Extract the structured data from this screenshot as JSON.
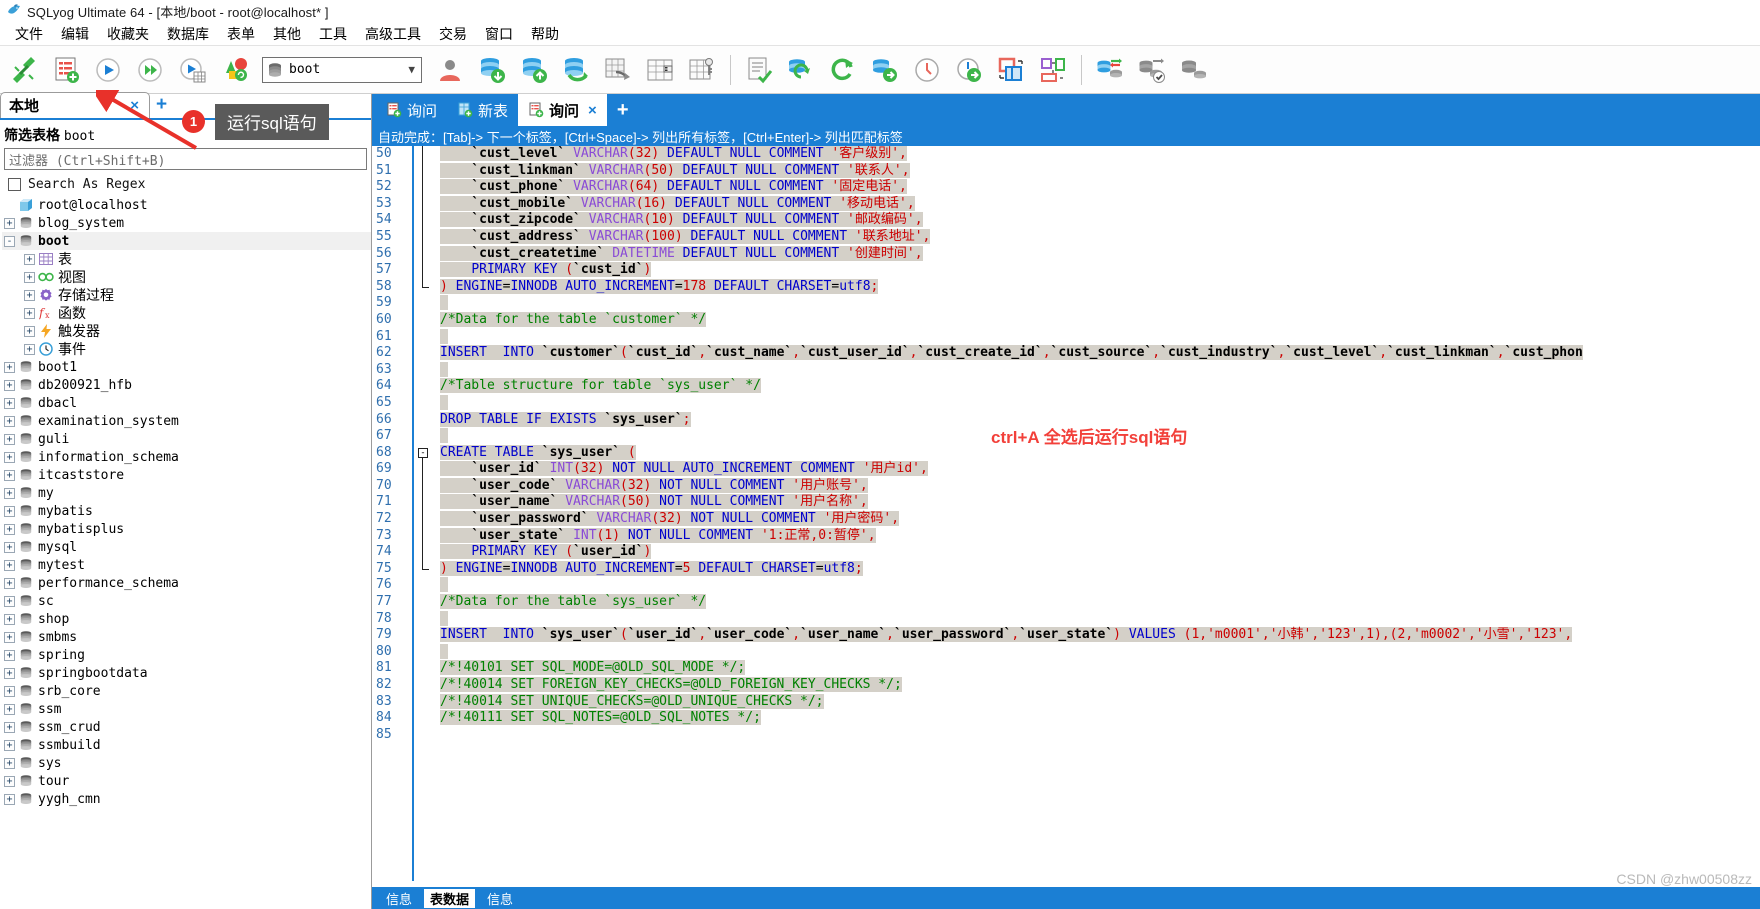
{
  "window": {
    "title": "SQLyog Ultimate 64 - [本地/boot - root@localhost* ]",
    "app_icon": "sqlyog-dolphin-icon"
  },
  "menubar": {
    "items": [
      {
        "label": "文件",
        "name": "menu-file"
      },
      {
        "label": "编辑",
        "name": "menu-edit"
      },
      {
        "label": "收藏夹",
        "name": "menu-favorites"
      },
      {
        "label": "数据库",
        "name": "menu-database"
      },
      {
        "label": "表单",
        "name": "menu-table"
      },
      {
        "label": "其他",
        "name": "menu-other"
      },
      {
        "label": "工具",
        "name": "menu-tools"
      },
      {
        "label": "高级工具",
        "name": "menu-powertools"
      },
      {
        "label": "交易",
        "name": "menu-transaction"
      },
      {
        "label": "窗口",
        "name": "menu-window"
      },
      {
        "label": "帮助",
        "name": "menu-help"
      }
    ]
  },
  "toolbar": {
    "database_value": "boot",
    "buttons": [
      "new-connection-icon",
      "new-query-tab-icon",
      "execute-query-icon",
      "execute-all-queries-icon",
      "execute-query-to-grid-icon",
      "refresh-objects-icon"
    ],
    "buttons2": [
      "user-manager-icon",
      "backup-database-icon",
      "restore-database-icon",
      "export-database-icon",
      "export-as-csv-icon",
      "import-external-data-icon",
      "manage-indexes-icon"
    ],
    "buttons3": [
      "table-diagnostics-icon",
      "flush-objects-icon",
      "refresh-icon",
      "sync-database-icon",
      "query-history-icon",
      "scheduled-backup-icon",
      "copy-database-icon",
      "object-browser-layout-icon"
    ],
    "buttons4": [
      "data-sync-icon",
      "schema-sync-icon",
      "schema-compare-icon"
    ]
  },
  "left_panel": {
    "connection_tab": {
      "label": "本地",
      "close": "×"
    },
    "add_tab": "+",
    "filter_label_prefix": "筛选表格",
    "filter_label_db": "boot",
    "filter_placeholder": "过滤器 (Ctrl+Shift+B)",
    "search_as_regex": "Search As Regex",
    "tree": [
      {
        "label": "root@localhost",
        "icon": "server-icon",
        "indent": 0,
        "expander": "none",
        "bold": false,
        "cn": false
      },
      {
        "label": "blog_system",
        "icon": "database-icon",
        "indent": 0,
        "expander": "+",
        "bold": false,
        "cn": false
      },
      {
        "label": "boot",
        "icon": "database-icon",
        "indent": 0,
        "expander": "-",
        "bold": true,
        "cn": false,
        "selected": true
      },
      {
        "label": "表",
        "icon": "tables-icon",
        "indent": 1,
        "expander": "+",
        "bold": false,
        "cn": true
      },
      {
        "label": "视图",
        "icon": "views-icon",
        "indent": 1,
        "expander": "+",
        "bold": false,
        "cn": true
      },
      {
        "label": "存储过程",
        "icon": "procedures-icon",
        "indent": 1,
        "expander": "+",
        "bold": false,
        "cn": true
      },
      {
        "label": "函数",
        "icon": "functions-icon",
        "indent": 1,
        "expander": "+",
        "bold": false,
        "cn": true
      },
      {
        "label": "触发器",
        "icon": "triggers-icon",
        "indent": 1,
        "expander": "+",
        "bold": false,
        "cn": true
      },
      {
        "label": "事件",
        "icon": "events-icon",
        "indent": 1,
        "expander": "+",
        "bold": false,
        "cn": true
      },
      {
        "label": "boot1",
        "icon": "database-icon",
        "indent": 0,
        "expander": "+",
        "bold": false,
        "cn": false
      },
      {
        "label": "db200921_hfb",
        "icon": "database-icon",
        "indent": 0,
        "expander": "+",
        "bold": false,
        "cn": false
      },
      {
        "label": "dbacl",
        "icon": "database-icon",
        "indent": 0,
        "expander": "+",
        "bold": false,
        "cn": false
      },
      {
        "label": "examination_system",
        "icon": "database-icon",
        "indent": 0,
        "expander": "+",
        "bold": false,
        "cn": false
      },
      {
        "label": "guli",
        "icon": "database-icon",
        "indent": 0,
        "expander": "+",
        "bold": false,
        "cn": false
      },
      {
        "label": "information_schema",
        "icon": "database-icon",
        "indent": 0,
        "expander": "+",
        "bold": false,
        "cn": false
      },
      {
        "label": "itcaststore",
        "icon": "database-icon",
        "indent": 0,
        "expander": "+",
        "bold": false,
        "cn": false
      },
      {
        "label": "my",
        "icon": "database-icon",
        "indent": 0,
        "expander": "+",
        "bold": false,
        "cn": false
      },
      {
        "label": "mybatis",
        "icon": "database-icon",
        "indent": 0,
        "expander": "+",
        "bold": false,
        "cn": false
      },
      {
        "label": "mybatisplus",
        "icon": "database-icon",
        "indent": 0,
        "expander": "+",
        "bold": false,
        "cn": false
      },
      {
        "label": "mysql",
        "icon": "database-icon",
        "indent": 0,
        "expander": "+",
        "bold": false,
        "cn": false
      },
      {
        "label": "mytest",
        "icon": "database-icon",
        "indent": 0,
        "expander": "+",
        "bold": false,
        "cn": false
      },
      {
        "label": "performance_schema",
        "icon": "database-icon",
        "indent": 0,
        "expander": "+",
        "bold": false,
        "cn": false
      },
      {
        "label": "sc",
        "icon": "database-icon",
        "indent": 0,
        "expander": "+",
        "bold": false,
        "cn": false
      },
      {
        "label": "shop",
        "icon": "database-icon",
        "indent": 0,
        "expander": "+",
        "bold": false,
        "cn": false
      },
      {
        "label": "smbms",
        "icon": "database-icon",
        "indent": 0,
        "expander": "+",
        "bold": false,
        "cn": false
      },
      {
        "label": "spring",
        "icon": "database-icon",
        "indent": 0,
        "expander": "+",
        "bold": false,
        "cn": false
      },
      {
        "label": "springbootdata",
        "icon": "database-icon",
        "indent": 0,
        "expander": "+",
        "bold": false,
        "cn": false
      },
      {
        "label": "srb_core",
        "icon": "database-icon",
        "indent": 0,
        "expander": "+",
        "bold": false,
        "cn": false
      },
      {
        "label": "ssm",
        "icon": "database-icon",
        "indent": 0,
        "expander": "+",
        "bold": false,
        "cn": false
      },
      {
        "label": "ssm_crud",
        "icon": "database-icon",
        "indent": 0,
        "expander": "+",
        "bold": false,
        "cn": false
      },
      {
        "label": "ssmbuild",
        "icon": "database-icon",
        "indent": 0,
        "expander": "+",
        "bold": false,
        "cn": false
      },
      {
        "label": "sys",
        "icon": "database-icon",
        "indent": 0,
        "expander": "+",
        "bold": false,
        "cn": false
      },
      {
        "label": "tour",
        "icon": "database-icon",
        "indent": 0,
        "expander": "+",
        "bold": false,
        "cn": false
      },
      {
        "label": "yygh_cmn",
        "icon": "database-icon",
        "indent": 0,
        "expander": "+",
        "bold": false,
        "cn": false
      }
    ]
  },
  "editor": {
    "tabs": [
      {
        "label": "询问",
        "icon": "query-tab-icon",
        "active": false,
        "closable": false
      },
      {
        "label": "新表",
        "icon": "new-table-tab-icon",
        "active": false,
        "closable": false
      },
      {
        "label": "询问",
        "icon": "query-tab-icon",
        "active": true,
        "closable": true,
        "close": "×"
      }
    ],
    "add_tab": "+",
    "autocomplete_hint": "自动完成：[Tab]-> 下一个标签，[Ctrl+Space]-> 列出所有标签，[Ctrl+Enter]-> 列出匹配标签",
    "first_line_number": 50,
    "lines": [
      {
        "n": 50,
        "sel": true,
        "html": "    <span class=\"id\">`cust_level`</span> <span class=\"ty\">VARCHAR</span><span class=\"pn\">(</span><span class=\"num\">32</span><span class=\"pn\">)</span> <span class=\"k\">DEFAULT</span> <span class=\"k\">NULL</span> <span class=\"k\">COMMENT</span> <span class=\"st\">'客户级别'</span><span class=\"pn\">,</span>"
      },
      {
        "n": 51,
        "sel": true,
        "html": "    <span class=\"id\">`cust_linkman`</span> <span class=\"ty\">VARCHAR</span><span class=\"pn\">(</span><span class=\"num\">50</span><span class=\"pn\">)</span> <span class=\"k\">DEFAULT</span> <span class=\"k\">NULL</span> <span class=\"k\">COMMENT</span> <span class=\"st\">'联系人'</span><span class=\"pn\">,</span>"
      },
      {
        "n": 52,
        "sel": true,
        "html": "    <span class=\"id\">`cust_phone`</span> <span class=\"ty\">VARCHAR</span><span class=\"pn\">(</span><span class=\"num\">64</span><span class=\"pn\">)</span> <span class=\"k\">DEFAULT</span> <span class=\"k\">NULL</span> <span class=\"k\">COMMENT</span> <span class=\"st\">'固定电话'</span><span class=\"pn\">,</span>"
      },
      {
        "n": 53,
        "sel": true,
        "html": "    <span class=\"id\">`cust_mobile`</span> <span class=\"ty\">VARCHAR</span><span class=\"pn\">(</span><span class=\"num\">16</span><span class=\"pn\">)</span> <span class=\"k\">DEFAULT</span> <span class=\"k\">NULL</span> <span class=\"k\">COMMENT</span> <span class=\"st\">'移动电话'</span><span class=\"pn\">,</span>"
      },
      {
        "n": 54,
        "sel": true,
        "html": "    <span class=\"id\">`cust_zipcode`</span> <span class=\"ty\">VARCHAR</span><span class=\"pn\">(</span><span class=\"num\">10</span><span class=\"pn\">)</span> <span class=\"k\">DEFAULT</span> <span class=\"k\">NULL</span> <span class=\"k\">COMMENT</span> <span class=\"st\">'邮政编码'</span><span class=\"pn\">,</span>"
      },
      {
        "n": 55,
        "sel": true,
        "html": "    <span class=\"id\">`cust_address`</span> <span class=\"ty\">VARCHAR</span><span class=\"pn\">(</span><span class=\"num\">100</span><span class=\"pn\">)</span> <span class=\"k\">DEFAULT</span> <span class=\"k\">NULL</span> <span class=\"k\">COMMENT</span> <span class=\"st\">'联系地址'</span><span class=\"pn\">,</span>"
      },
      {
        "n": 56,
        "sel": true,
        "html": "    <span class=\"id\">`cust_createtime`</span> <span class=\"ty\">DATETIME</span> <span class=\"k\">DEFAULT</span> <span class=\"k\">NULL</span> <span class=\"k\">COMMENT</span> <span class=\"st\">'创建时间'</span><span class=\"pn\">,</span>"
      },
      {
        "n": 57,
        "sel": true,
        "html": "    <span class=\"k\">PRIMARY</span> <span class=\"k\">KEY</span> <span class=\"pn\">(</span><span class=\"id\">`cust_id`</span><span class=\"pn\">)</span>"
      },
      {
        "n": 58,
        "sel": true,
        "html": "<span class=\"pn\">)</span> <span class=\"k\">ENGINE</span>=<span class=\"k\">INNODB</span> <span class=\"k\">AUTO_INCREMENT</span>=<span class=\"num\">178</span> <span class=\"k\">DEFAULT</span> <span class=\"k\">CHARSET</span>=<span class=\"k\">utf8</span><span class=\"pn\">;</span>"
      },
      {
        "n": 59,
        "sel": true,
        "html": ""
      },
      {
        "n": 60,
        "sel": true,
        "html": "<span class=\"cm\">/*Data for the table `customer` */</span>"
      },
      {
        "n": 61,
        "sel": true,
        "html": ""
      },
      {
        "n": 62,
        "sel": true,
        "html": "<span class=\"k\">INSERT</span>  <span class=\"k\">INTO</span> <span class=\"id\">`customer`</span><span class=\"pn\">(</span><span class=\"id\">`cust_id`</span><span class=\"pn\">,</span><span class=\"id\">`cust_name`</span><span class=\"pn\">,</span><span class=\"id\">`cust_user_id`</span><span class=\"pn\">,</span><span class=\"id\">`cust_create_id`</span><span class=\"pn\">,</span><span class=\"id\">`cust_source`</span><span class=\"pn\">,</span><span class=\"id\">`cust_industry`</span><span class=\"pn\">,</span><span class=\"id\">`cust_level`</span><span class=\"pn\">,</span><span class=\"id\">`cust_linkman`</span><span class=\"pn\">,</span><span class=\"id\">`cust_phon</span>"
      },
      {
        "n": 63,
        "sel": true,
        "html": ""
      },
      {
        "n": 64,
        "sel": true,
        "html": "<span class=\"cm\">/*Table structure for table `sys_user` */</span>"
      },
      {
        "n": 65,
        "sel": true,
        "html": ""
      },
      {
        "n": 66,
        "sel": true,
        "html": "<span class=\"k\">DROP</span> <span class=\"k\">TABLE</span> <span class=\"k\">IF</span> <span class=\"k\">EXISTS</span> <span class=\"id\">`sys_user`</span><span class=\"pn\">;</span>"
      },
      {
        "n": 67,
        "sel": true,
        "html": ""
      },
      {
        "n": 68,
        "sel": true,
        "html": "<span class=\"k\">CREATE</span> <span class=\"k\">TABLE</span> <span class=\"id\">`sys_user`</span> <span class=\"pn\">(</span>"
      },
      {
        "n": 69,
        "sel": true,
        "html": "    <span class=\"id\">`user_id`</span> <span class=\"ty\">INT</span><span class=\"pn\">(</span><span class=\"num\">32</span><span class=\"pn\">)</span> <span class=\"k\">NOT</span> <span class=\"k\">NULL</span> <span class=\"k\">AUTO_INCREMENT</span> <span class=\"k\">COMMENT</span> <span class=\"st\">'用户id'</span><span class=\"pn\">,</span>"
      },
      {
        "n": 70,
        "sel": true,
        "html": "    <span class=\"id\">`user_code`</span> <span class=\"ty\">VARCHAR</span><span class=\"pn\">(</span><span class=\"num\">32</span><span class=\"pn\">)</span> <span class=\"k\">NOT</span> <span class=\"k\">NULL</span> <span class=\"k\">COMMENT</span> <span class=\"st\">'用户账号'</span><span class=\"pn\">,</span>"
      },
      {
        "n": 71,
        "sel": true,
        "html": "    <span class=\"id\">`user_name`</span> <span class=\"ty\">VARCHAR</span><span class=\"pn\">(</span><span class=\"num\">50</span><span class=\"pn\">)</span> <span class=\"k\">NOT</span> <span class=\"k\">NULL</span> <span class=\"k\">COMMENT</span> <span class=\"st\">'用户名称'</span><span class=\"pn\">,</span>"
      },
      {
        "n": 72,
        "sel": true,
        "html": "    <span class=\"id\">`user_password`</span> <span class=\"ty\">VARCHAR</span><span class=\"pn\">(</span><span class=\"num\">32</span><span class=\"pn\">)</span> <span class=\"k\">NOT</span> <span class=\"k\">NULL</span> <span class=\"k\">COMMENT</span> <span class=\"st\">'用户密码'</span><span class=\"pn\">,</span>"
      },
      {
        "n": 73,
        "sel": true,
        "html": "    <span class=\"id\">`user_state`</span> <span class=\"ty\">INT</span><span class=\"pn\">(</span><span class=\"num\">1</span><span class=\"pn\">)</span> <span class=\"k\">NOT</span> <span class=\"k\">NULL</span> <span class=\"k\">COMMENT</span> <span class=\"st\">'1:正常,0:暂停'</span><span class=\"pn\">,</span>"
      },
      {
        "n": 74,
        "sel": true,
        "html": "    <span class=\"k\">PRIMARY</span> <span class=\"k\">KEY</span> <span class=\"pn\">(</span><span class=\"id\">`user_id`</span><span class=\"pn\">)</span>"
      },
      {
        "n": 75,
        "sel": true,
        "html": "<span class=\"pn\">)</span> <span class=\"k\">ENGINE</span>=<span class=\"k\">INNODB</span> <span class=\"k\">AUTO_INCREMENT</span>=<span class=\"num\">5</span> <span class=\"k\">DEFAULT</span> <span class=\"k\">CHARSET</span>=<span class=\"k\">utf8</span><span class=\"pn\">;</span>"
      },
      {
        "n": 76,
        "sel": true,
        "html": ""
      },
      {
        "n": 77,
        "sel": true,
        "html": "<span class=\"cm\">/*Data for the table `sys_user` */</span>"
      },
      {
        "n": 78,
        "sel": true,
        "html": ""
      },
      {
        "n": 79,
        "sel": true,
        "html": "<span class=\"k\">INSERT</span>  <span class=\"k\">INTO</span> <span class=\"id\">`sys_user`</span><span class=\"pn\">(</span><span class=\"id\">`user_id`</span><span class=\"pn\">,</span><span class=\"id\">`user_code`</span><span class=\"pn\">,</span><span class=\"id\">`user_name`</span><span class=\"pn\">,</span><span class=\"id\">`user_password`</span><span class=\"pn\">,</span><span class=\"id\">`user_state`</span><span class=\"pn\">)</span> <span class=\"k\">VALUES</span> <span class=\"pn\">(</span><span class=\"num\">1</span><span class=\"pn\">,</span><span class=\"st\">'m0001'</span><span class=\"pn\">,</span><span class=\"st\">'小韩'</span><span class=\"pn\">,</span><span class=\"st\">'123'</span><span class=\"pn\">,</span><span class=\"num\">1</span><span class=\"pn\">),(</span><span class=\"num\">2</span><span class=\"pn\">,</span><span class=\"st\">'m0002'</span><span class=\"pn\">,</span><span class=\"st\">'小雪'</span><span class=\"pn\">,</span><span class=\"st\">'123'</span><span class=\"pn\">,</span>"
      },
      {
        "n": 80,
        "sel": true,
        "html": ""
      },
      {
        "n": 81,
        "sel": true,
        "html": "<span class=\"cm\">/*!40101 SET SQL_MODE=@OLD_SQL_MODE */;</span>"
      },
      {
        "n": 82,
        "sel": true,
        "html": "<span class=\"cm\">/*!40014 SET FOREIGN_KEY_CHECKS=@OLD_FOREIGN_KEY_CHECKS */;</span>"
      },
      {
        "n": 83,
        "sel": true,
        "html": "<span class=\"cm\">/*!40014 SET UNIQUE_CHECKS=@OLD_UNIQUE_CHECKS */;</span>"
      },
      {
        "n": 84,
        "sel": true,
        "html": "<span class=\"cm\">/*!40111 SET SQL_NOTES=@OLD_SQL_NOTES */;</span>"
      },
      {
        "n": 85,
        "sel": false,
        "html": ""
      }
    ]
  },
  "annotations": {
    "badge_number": "1",
    "tooltip_text": "运行sql语句",
    "red_note": "ctrl+A 全选后运行sql语句",
    "red_color": "#f2403a",
    "badge_color": "#e8312a",
    "tooltip_bg": "#5a5a5a"
  },
  "bottom": {
    "tabs": [
      {
        "label": "信息",
        "active": false
      },
      {
        "label": "表数据",
        "active": true
      },
      {
        "label": "信息",
        "active": false
      }
    ]
  },
  "watermark": "CSDN @zhw00508zz"
}
